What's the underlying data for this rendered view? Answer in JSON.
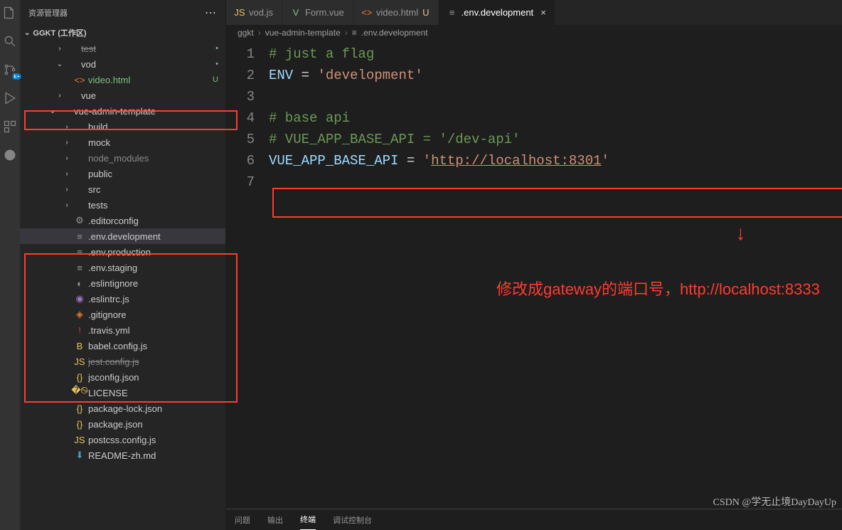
{
  "sidebar": {
    "title": "资源管理器",
    "workspace": "GGKT (工作区)",
    "tree": [
      {
        "ind": 50,
        "tw": "›",
        "icon": "",
        "lbl": "test",
        "struck": true,
        "status": "•",
        "statusClass": "dot"
      },
      {
        "ind": 50,
        "tw": "⌄",
        "icon": "",
        "lbl": "vod",
        "lblClass": "",
        "status": "•",
        "statusClass": "dot"
      },
      {
        "ind": 60,
        "tw": "",
        "icon": "<>",
        "iconClass": "ic-orange",
        "lbl": "video.html",
        "lblClass": "c-green",
        "status": "U",
        "statusClass": "c-green"
      },
      {
        "ind": 50,
        "tw": "›",
        "icon": "",
        "lbl": "vue",
        "status": ""
      },
      {
        "ind": 40,
        "tw": "⌄",
        "icon": "",
        "lbl": "vue-admin-template",
        "status": ""
      },
      {
        "ind": 60,
        "tw": "›",
        "icon": "",
        "lbl": "build",
        "status": ""
      },
      {
        "ind": 60,
        "tw": "›",
        "icon": "",
        "lbl": "mock",
        "status": ""
      },
      {
        "ind": 60,
        "tw": "›",
        "icon": "",
        "lbl": "node_modules",
        "lblClass": "dim",
        "status": ""
      },
      {
        "ind": 60,
        "tw": "›",
        "icon": "",
        "lbl": "public",
        "status": ""
      },
      {
        "ind": 60,
        "tw": "›",
        "icon": "",
        "lbl": "src",
        "status": ""
      },
      {
        "ind": 60,
        "tw": "›",
        "icon": "",
        "lbl": "tests",
        "status": ""
      },
      {
        "ind": 60,
        "tw": "",
        "icon": "⚙",
        "iconClass": "ic-gray",
        "lbl": ".editorconfig",
        "status": ""
      },
      {
        "ind": 60,
        "tw": "",
        "icon": "≡",
        "iconClass": "ic-gray",
        "lbl": ".env.development",
        "selected": true,
        "status": ""
      },
      {
        "ind": 60,
        "tw": "",
        "icon": "≡",
        "iconClass": "ic-gray",
        "lbl": ".env.production",
        "status": ""
      },
      {
        "ind": 60,
        "tw": "",
        "icon": "≡",
        "iconClass": "ic-gray",
        "lbl": ".env.staging",
        "status": ""
      },
      {
        "ind": 60,
        "tw": "",
        "icon": "◐",
        "iconClass": "ic-gray",
        "lbl": ".eslintignore",
        "status": ""
      },
      {
        "ind": 60,
        "tw": "",
        "icon": "◉",
        "iconClass": "ic-purple",
        "lbl": ".eslintrc.js",
        "status": ""
      },
      {
        "ind": 60,
        "tw": "",
        "icon": "◈",
        "iconClass": "ic-orange",
        "lbl": ".gitignore",
        "status": ""
      },
      {
        "ind": 60,
        "tw": "",
        "icon": "!",
        "iconClass": "ic-red",
        "lbl": ".travis.yml",
        "status": ""
      },
      {
        "ind": 60,
        "tw": "",
        "icon": "B",
        "iconClass": "ic-yellow",
        "lbl": "babel.config.js",
        "status": ""
      },
      {
        "ind": 60,
        "tw": "",
        "icon": "JS",
        "iconClass": "ic-yellow",
        "lbl": "jest.config.js",
        "struck": true,
        "status": ""
      },
      {
        "ind": 60,
        "tw": "",
        "icon": "{}",
        "iconClass": "ic-yellow",
        "lbl": "jsconfig.json",
        "status": ""
      },
      {
        "ind": 60,
        "tw": "",
        "icon": "�࿊",
        "iconClass": "ic-yellow",
        "lbl": "LICENSE",
        "status": ""
      },
      {
        "ind": 60,
        "tw": "",
        "icon": "{}",
        "iconClass": "ic-yellow",
        "lbl": "package-lock.json",
        "status": ""
      },
      {
        "ind": 60,
        "tw": "",
        "icon": "{}",
        "iconClass": "ic-yellow",
        "lbl": "package.json",
        "status": ""
      },
      {
        "ind": 60,
        "tw": "",
        "icon": "JS",
        "iconClass": "ic-yellow",
        "lbl": "postcss.config.js",
        "status": ""
      },
      {
        "ind": 60,
        "tw": "",
        "icon": "⬇",
        "iconClass": "ic-blue",
        "lbl": "README-zh.md",
        "status": ""
      }
    ]
  },
  "tabs": [
    {
      "icon": "JS",
      "iconClass": "ic-yellow",
      "label": "vod.js",
      "active": false
    },
    {
      "icon": "V",
      "iconClass": "ic-green",
      "label": "Form.vue",
      "active": false
    },
    {
      "icon": "<>",
      "iconClass": "ic-orange",
      "label": "video.html",
      "suffix": "U",
      "active": false
    },
    {
      "icon": "≡",
      "iconClass": "ic-gray",
      "label": ".env.development",
      "active": true,
      "close": true
    }
  ],
  "breadcrumb": [
    "ggkt",
    "vue-admin-template",
    ".env.development"
  ],
  "breadcrumb_icon": "≡",
  "code": {
    "lines": [
      {
        "n": 1,
        "html": "<span class='tok-comment'># just a flag</span>"
      },
      {
        "n": 2,
        "html": "<span class='tok-var'>ENV</span> <span class='tok-op'>=</span> <span class='tok-str'>'development'</span>"
      },
      {
        "n": 3,
        "html": ""
      },
      {
        "n": 4,
        "html": "<span class='tok-comment'># base api</span>"
      },
      {
        "n": 5,
        "html": "<span class='tok-comment'># VUE_APP_BASE_API = '/dev-api'</span>"
      },
      {
        "n": 6,
        "html": "<span class='tok-var'>VUE_APP_BASE_API</span> <span class='tok-op'>=</span> <span class='tok-str'>'</span><span class='tok-url'>http://localhost:8301</span><span class='tok-str'>'</span>"
      },
      {
        "n": 7,
        "html": ""
      }
    ]
  },
  "annotation": "修改成gateway的端口号，http://localhost:8333",
  "panel": {
    "tabs": [
      "问题",
      "输出",
      "终端",
      "调试控制台"
    ],
    "active": 2
  },
  "watermark": "CSDN @学无止境DayDayUp"
}
